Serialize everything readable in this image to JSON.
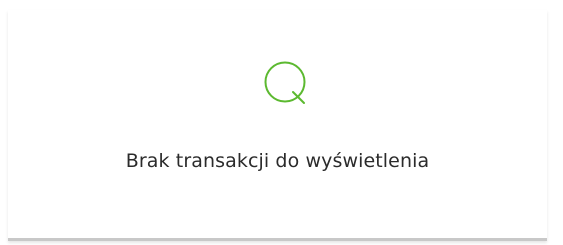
{
  "empty_state": {
    "icon": "search-icon",
    "icon_color": "#5cb930",
    "message": "Brak transakcji do wyświetlenia"
  }
}
